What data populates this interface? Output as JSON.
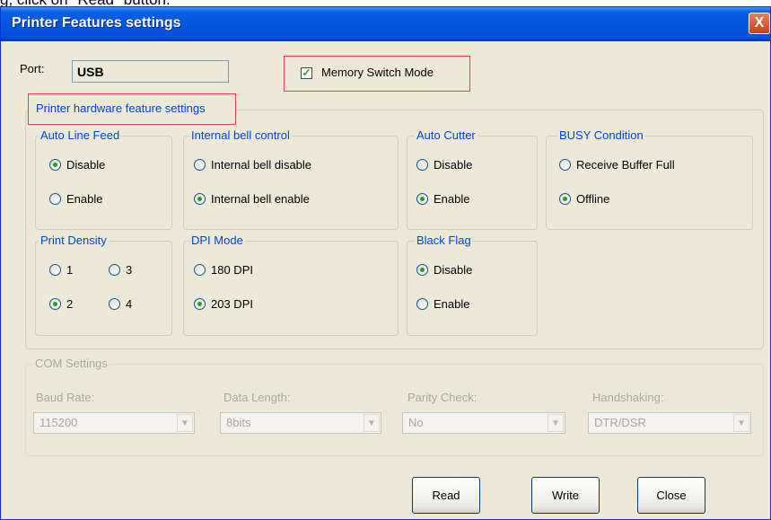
{
  "caption": "g, click on \"Read\" button.",
  "window": {
    "title": "Printer Features settings",
    "close_glyph": "X"
  },
  "port": {
    "label": "Port:",
    "value": "USB"
  },
  "memory_switch": {
    "label": "Memory Switch Mode",
    "checked": true
  },
  "hardware_section": {
    "title": "Printer hardware feature settings"
  },
  "groups": {
    "auto_line_feed": {
      "title": "Auto Line Feed",
      "options": [
        "Disable",
        "Enable"
      ],
      "selected": "Disable"
    },
    "internal_bell": {
      "title": "Internal bell control",
      "options": [
        "Internal bell disable",
        "Internal bell enable"
      ],
      "selected": "Internal bell enable"
    },
    "auto_cutter": {
      "title": "Auto Cutter",
      "options": [
        "Disable",
        "Enable"
      ],
      "selected": "Enable"
    },
    "busy_condition": {
      "title": "BUSY Condition",
      "options": [
        "Receive Buffer Full",
        "Offline"
      ],
      "selected": "Offline"
    },
    "print_density": {
      "title": "Print Density",
      "options": [
        "1",
        "3",
        "2",
        "4"
      ],
      "selected": "2"
    },
    "dpi_mode": {
      "title": "DPI Mode",
      "options": [
        "180 DPI",
        "203 DPI"
      ],
      "selected": "203 DPI"
    },
    "black_flag": {
      "title": "Black Flag",
      "options": [
        "Disable",
        "Enable"
      ],
      "selected": "Disable"
    }
  },
  "com_settings": {
    "title": "COM Settings",
    "baud_rate": {
      "label": "Baud Rate:",
      "value": "115200"
    },
    "data_length": {
      "label": "Data Length:",
      "value": "8bits"
    },
    "parity_check": {
      "label": "Parity Check:",
      "value": "No"
    },
    "handshaking": {
      "label": "Handshaking:",
      "value": "DTR/DSR"
    }
  },
  "buttons": {
    "read": "Read",
    "write": "Write",
    "close": "Close"
  },
  "colors": {
    "titlebar": "#0556dc",
    "group_title": "#0046d5",
    "highlight_frame": "#e0454a",
    "radio_dot": "#21a121",
    "dialog_bg": "#ece9d8"
  },
  "icons": {
    "check": "check-icon",
    "radio_dot": "radio-dot-icon",
    "dropdown": "chevron-down-icon"
  }
}
